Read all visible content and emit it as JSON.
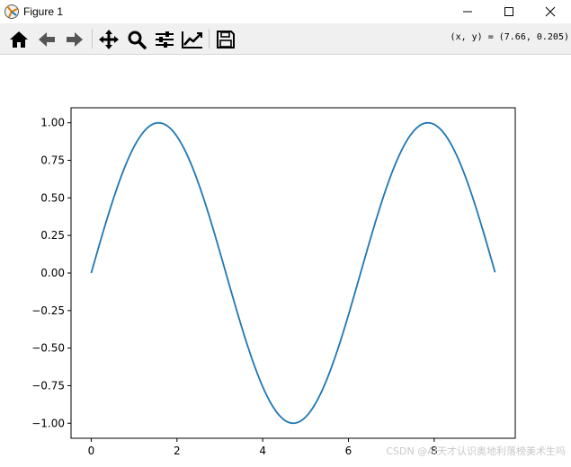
{
  "window": {
    "title": "Figure 1",
    "app_icon": "matplotlib-figure-icon",
    "controls": [
      "minimize-icon",
      "maximize-icon",
      "close-icon"
    ]
  },
  "toolbar": {
    "buttons": [
      {
        "name": "home-button",
        "icon": "home-icon"
      },
      {
        "name": "back-button",
        "icon": "arrow-left-icon"
      },
      {
        "name": "forward-button",
        "icon": "arrow-right-icon"
      },
      {
        "name": "pan-button",
        "icon": "move-arrows-icon"
      },
      {
        "name": "zoom-button",
        "icon": "magnifier-icon"
      },
      {
        "name": "subplots-button",
        "icon": "sliders-icon"
      },
      {
        "name": "edit-axes-button",
        "icon": "line-chart-icon"
      },
      {
        "name": "save-button",
        "icon": "floppy-disk-icon"
      }
    ],
    "coordinates": "(x, y) = (7.66, 0.205)"
  },
  "chart_data": {
    "type": "line",
    "function": "sin(x)",
    "x_range": [
      0,
      9.42
    ],
    "sample_x": [
      0,
      1.57,
      3.14,
      4.71,
      6.28,
      7.85,
      9.42
    ],
    "sample_y": [
      0.0,
      1.0,
      0.0,
      -1.0,
      0.0,
      1.0,
      0.0
    ],
    "xticks": [
      0,
      2,
      4,
      6,
      8
    ],
    "yticks": [
      -1.0,
      -0.75,
      -0.5,
      -0.25,
      0.0,
      0.25,
      0.5,
      0.75,
      1.0
    ],
    "xtick_labels": [
      "0",
      "2",
      "4",
      "6",
      "8"
    ],
    "ytick_labels": [
      "−1.00",
      "−0.75",
      "−0.50",
      "−0.25",
      "0.00",
      "0.25",
      "0.50",
      "0.75",
      "1.00"
    ],
    "xlim": [
      -0.471,
      9.891
    ],
    "ylim": [
      -1.1,
      1.1
    ],
    "line_color": "#1f77b4",
    "grid": false
  },
  "watermark": "CSDN @AI天才认识奥地利落榜美术生吗"
}
